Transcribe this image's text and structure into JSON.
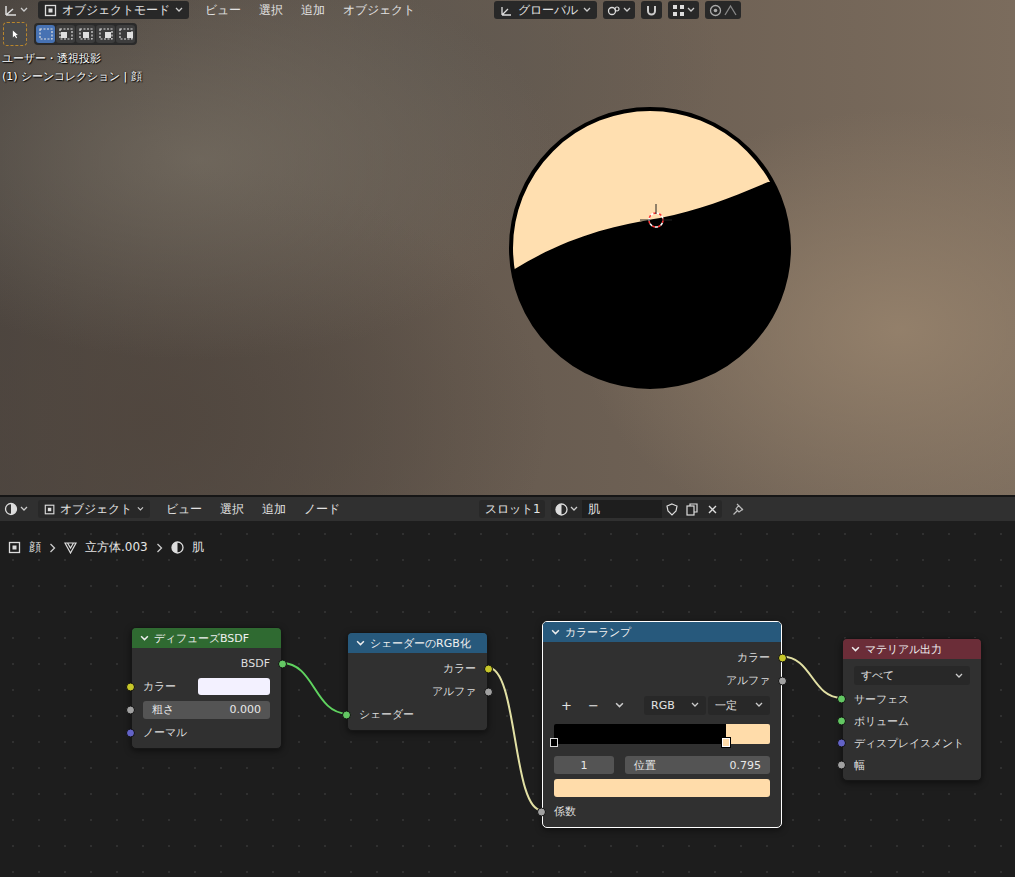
{
  "viewport": {
    "header": {
      "mode": "オブジェクトモード",
      "menus": [
        "ビュー",
        "選択",
        "追加",
        "オブジェクト"
      ],
      "orientation": "グローバル"
    },
    "toolbar": {
      "select_tool": {
        "selected": true
      },
      "select_modes": [
        {
          "selected": true
        },
        {
          "selected": false
        },
        {
          "selected": false
        },
        {
          "selected": false
        },
        {
          "selected": false
        }
      ]
    },
    "overlay": [
      "ユーザー・透視投影",
      "(1) シーンコレクション | 顔"
    ]
  },
  "node_editor": {
    "header": {
      "editor": "オブジェクト",
      "menus": [
        "ビュー",
        "選択",
        "追加",
        "ノード"
      ],
      "slot": "スロット1",
      "material": "肌"
    },
    "breadcrumb": [
      "顔",
      "立方体.003",
      "肌"
    ],
    "nodes": [
      {
        "title": "ディフューズBSDF",
        "color": "#2f6a31",
        "selected": false,
        "rows": [
          {
            "kind": "output",
            "label": "BSDF",
            "socket": "#63c763"
          },
          {
            "kind": "color-input",
            "label": "カラー",
            "socket": "#c7c729",
            "value": "#f3f1ff"
          },
          {
            "kind": "field",
            "label": "粗さ",
            "value": "0.000",
            "socket": "#a1a1a1"
          },
          {
            "kind": "input",
            "label": "ノーマル",
            "socket": "#6363c7"
          }
        ]
      },
      {
        "title": "シェーダーのRGB化",
        "color": "#27597c",
        "selected": false,
        "rows": [
          {
            "kind": "output",
            "label": "カラー",
            "socket": "#c7c729"
          },
          {
            "kind": "output",
            "label": "アルファ",
            "socket": "#a1a1a1"
          },
          {
            "kind": "input",
            "label": "シェーダー",
            "socket": "#63c763"
          }
        ]
      },
      {
        "title": "カラーランプ",
        "color": "#27597c",
        "selected": true,
        "rows": [
          {
            "kind": "output",
            "label": "カラー",
            "socket": "#c7c729"
          },
          {
            "kind": "output",
            "label": "アルファ",
            "socket": "#a1a1a1"
          },
          {
            "kind": "ramp-controls",
            "buttons": [
              "+",
              "−"
            ],
            "color_mode": "RGB",
            "interpolation": "一定"
          },
          {
            "kind": "ramp",
            "stops": [
              {
                "position": 0,
                "color": "#000000",
                "selected": false
              },
              {
                "position": 0.795,
                "color": "#ffdcaa",
                "selected": true
              }
            ]
          },
          {
            "kind": "stop-fields",
            "index": "1",
            "label": "位置",
            "value": "0.795"
          },
          {
            "kind": "swatch",
            "value": "#ffdcaa"
          },
          {
            "kind": "input",
            "label": "係数",
            "socket": "#a1a1a1"
          }
        ]
      },
      {
        "title": "マテリアル出力",
        "color": "#6b2d38",
        "selected": false,
        "rows": [
          {
            "kind": "dropdown",
            "value": "すべて"
          },
          {
            "kind": "input",
            "label": "サーフェス",
            "socket": "#63c763"
          },
          {
            "kind": "input",
            "label": "ボリューム",
            "socket": "#63c763"
          },
          {
            "kind": "input",
            "label": "ディスプレイスメント",
            "socket": "#6363c7"
          },
          {
            "kind": "input",
            "label": "幅",
            "socket": "#a1a1a1"
          }
        ]
      }
    ],
    "links": [
      {
        "color": "#5fd35f"
      },
      {
        "color": "#e2e0a4"
      },
      {
        "color": "#e2e0a4"
      }
    ]
  }
}
